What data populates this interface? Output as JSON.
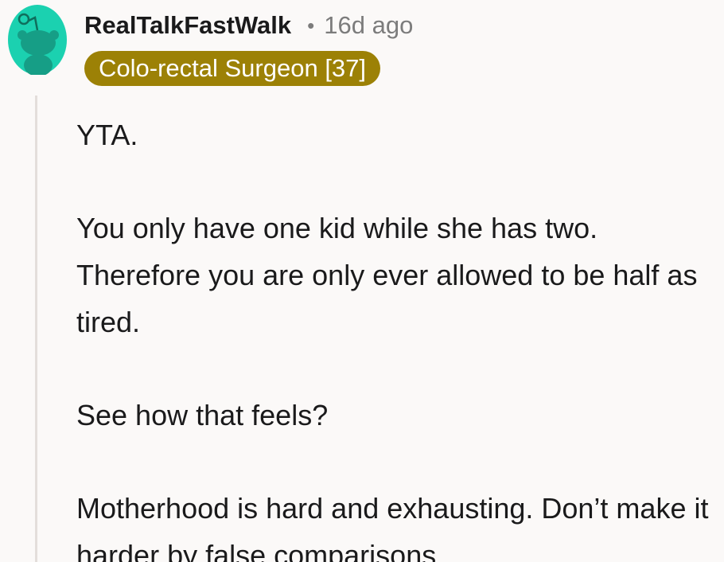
{
  "comment": {
    "author": "RealTalkFastWalk",
    "separator": "•",
    "timestamp": "16d ago",
    "flair": "Colo-rectal Surgeon [37]",
    "avatar_icon": "reddit-snoo-avatar-icon",
    "avatar_color": "#1bd1b0",
    "flair_color": "#9c8106",
    "paragraphs": [
      "YTA.",
      "You only have one kid while she has two. Therefore you are only ever allowed to be half as tired.",
      "See how that feels?",
      "Motherhood is hard and exhausting. Don’t make it harder by false comparisons."
    ]
  }
}
